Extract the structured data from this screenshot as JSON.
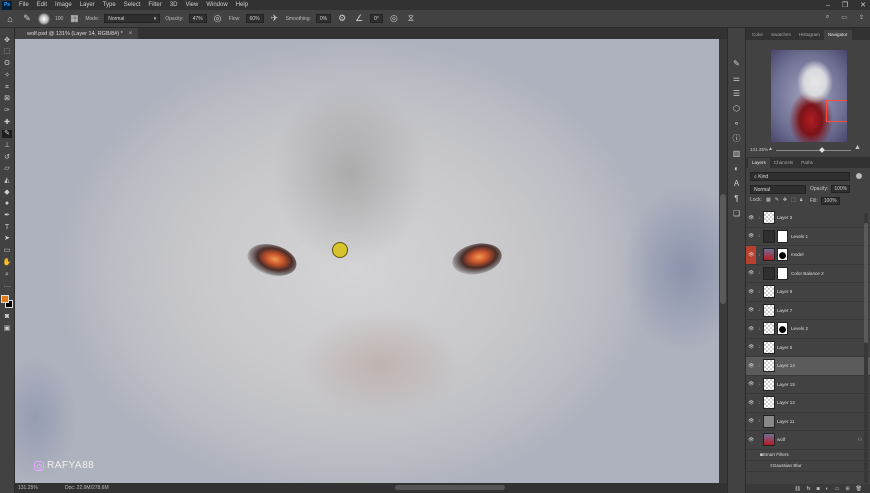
{
  "menubar": {
    "logo": "Ps",
    "items": [
      "File",
      "Edit",
      "Image",
      "Layer",
      "Type",
      "Select",
      "Filter",
      "3D",
      "View",
      "Window",
      "Help"
    ]
  },
  "options": {
    "brush_size": "100",
    "mode_label": "Mode:",
    "mode_value": "Normal",
    "opacity_label": "Opacity:",
    "opacity_value": "47%",
    "flow_label": "Flow:",
    "flow_value": "60%",
    "smoothing_label": "Smoothing:",
    "smoothing_value": "0%",
    "angle_value": "0°"
  },
  "document": {
    "tab_title": "wolf.psd @ 131% (Layer 14, RGB/8#) *",
    "tab_close": "×",
    "watermark": "RAFYA88"
  },
  "status": {
    "zoom": "131.25%",
    "doc_info": "Doc: 22.9M/278.6M"
  },
  "panels": {
    "top_tabs": [
      "Color",
      "Swatches",
      "Histogram",
      "Navigator"
    ],
    "navigator_zoom": "131.25%",
    "layers_tabs": [
      "Layers",
      "Channels",
      "Paths"
    ],
    "filter_kind": "Kind",
    "blend_mode": "Normal",
    "opacity_label": "Opacity:",
    "opacity_value": "100%",
    "lock_label": "Lock:",
    "fill_label": "Fill:",
    "fill_value": "100%"
  },
  "layers": [
    {
      "name": "Layer 3",
      "thumb": "checker",
      "mask": false
    },
    {
      "name": "Levels 1",
      "thumb": "adj",
      "mask": true
    },
    {
      "name": "model",
      "thumb": "photo",
      "mask": true,
      "mask_style": "black",
      "red_eye": true
    },
    {
      "name": "Color Balance 2",
      "thumb": "adj",
      "mask": true
    },
    {
      "name": "Layer 9",
      "thumb": "checker",
      "mask": false
    },
    {
      "name": "Layer 7",
      "thumb": "checker",
      "mask": false
    },
    {
      "name": "Levels 2",
      "thumb": "checker",
      "mask": true,
      "mask_style": "black"
    },
    {
      "name": "Layer 5",
      "thumb": "checker",
      "mask": false
    },
    {
      "name": "Layer 14",
      "thumb": "checker",
      "mask": false,
      "selected": true
    },
    {
      "name": "Layer 15",
      "thumb": "checker",
      "mask": false
    },
    {
      "name": "Layer 12",
      "thumb": "checker",
      "mask": false
    },
    {
      "name": "Layer 11",
      "thumb": "gray",
      "mask": false
    },
    {
      "name": "wolf",
      "thumb": "photo",
      "mask": false,
      "smart": true
    }
  ],
  "sublayers": [
    {
      "name": "Smart Filters"
    },
    {
      "name": "Gaussian Blur"
    }
  ],
  "colors": {
    "foreground": "#e07a1a",
    "background": "#000000",
    "brush_cursor": "#d8c42c",
    "navigator_box": "#ff4a3a"
  }
}
